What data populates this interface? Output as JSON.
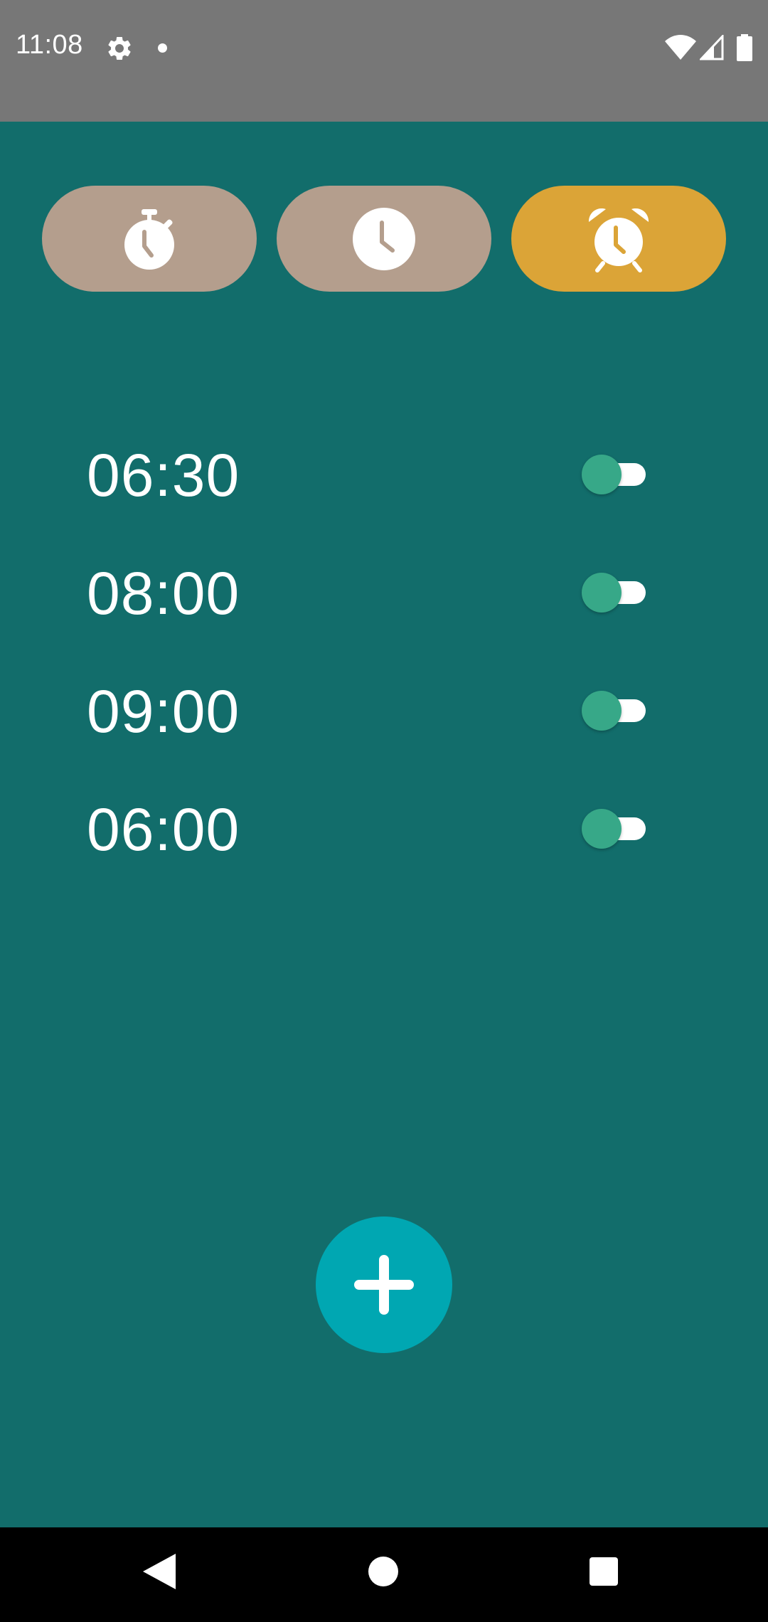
{
  "status_bar": {
    "time": "11:08",
    "icons": [
      "settings-gear-icon",
      "notification-dot-icon",
      "wifi-icon",
      "cell-signal-icon",
      "battery-icon"
    ]
  },
  "tabs": [
    {
      "name": "stopwatch",
      "icon": "stopwatch-icon",
      "active": false
    },
    {
      "name": "clock",
      "icon": "clock-icon",
      "active": false
    },
    {
      "name": "alarm",
      "icon": "alarm-clock-icon",
      "active": true
    }
  ],
  "alarms": [
    {
      "time": "06:30",
      "enabled": false
    },
    {
      "time": "08:00",
      "enabled": false
    },
    {
      "time": "09:00",
      "enabled": false
    },
    {
      "time": "06:00",
      "enabled": false
    }
  ],
  "fab": {
    "icon": "add-icon"
  },
  "nav_bar": {
    "icons": [
      "back-icon",
      "home-icon",
      "recents-icon"
    ]
  },
  "colors": {
    "background": "#126d6b",
    "status_bar": "#777777",
    "tab_inactive": "#b49e8d",
    "tab_active": "#dba437",
    "toggle_thumb": "#37a888",
    "fab": "#00a7b2"
  }
}
